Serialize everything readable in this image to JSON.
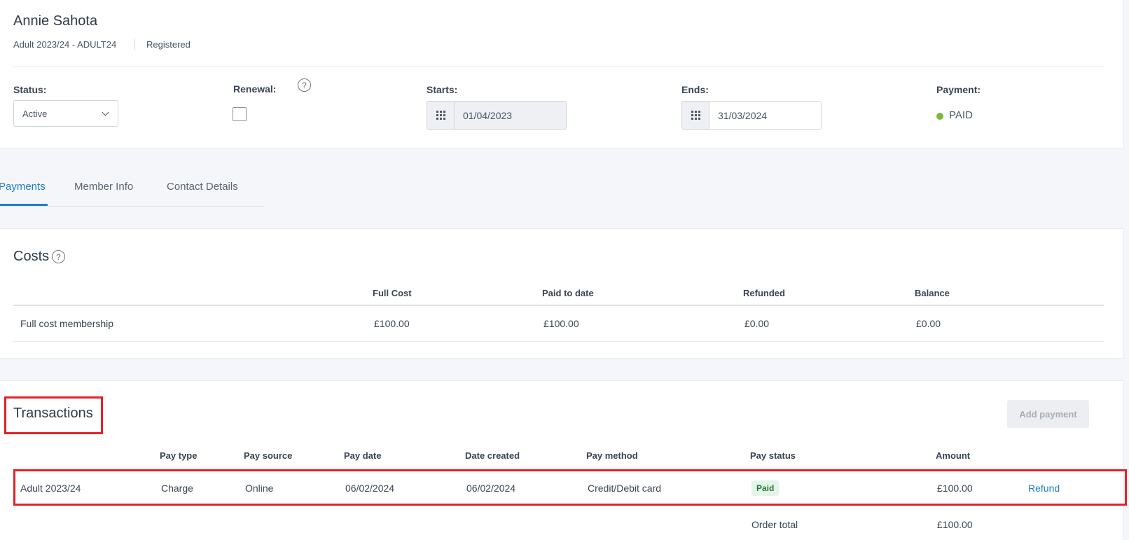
{
  "member": {
    "name": "Annie Sahota",
    "membership": "Adult 2023/24 - ADULT24",
    "registration_status": "Registered"
  },
  "fields": {
    "status_label": "Status:",
    "status_value": "Active",
    "renewal_label": "Renewal:",
    "help_glyph": "?",
    "starts_label": "Starts:",
    "starts_value": "01/04/2023",
    "ends_label": "Ends:",
    "ends_value": "31/03/2024",
    "payment_label": "Payment:",
    "payment_value": "PAID",
    "payment_color": "#7cb93a"
  },
  "tabs": [
    {
      "label": "Payments",
      "active": true
    },
    {
      "label": "Member Info",
      "active": false
    },
    {
      "label": "Contact Details",
      "active": false
    }
  ],
  "costs": {
    "title": "Costs",
    "headers": [
      "Full Cost",
      "Paid to date",
      "Refunded",
      "Balance"
    ],
    "rows": [
      {
        "name": "Full cost membership",
        "full_cost": "£100.00",
        "paid_to_date": "£100.00",
        "refunded": "£0.00",
        "balance": "£0.00"
      }
    ]
  },
  "transactions": {
    "title": "Transactions",
    "add_button": "Add payment",
    "headers": [
      "Pay type",
      "Pay source",
      "Pay date",
      "Date created",
      "Pay method",
      "Pay status",
      "Amount"
    ],
    "rows": [
      {
        "item": "Adult 2023/24",
        "pay_type": "Charge",
        "pay_source": "Online",
        "pay_date": "06/02/2024",
        "date_created": "06/02/2024",
        "pay_method": "Credit/Debit card",
        "pay_status": "Paid",
        "amount": "£100.00",
        "action": "Refund"
      }
    ],
    "order_total_label": "Order total",
    "order_total_value": "£100.00"
  },
  "colors": {
    "accent": "#1f7fc7",
    "highlight": "#e3222a",
    "paid_badge_bg": "#e4f4e8"
  },
  "icons": {
    "calendar": "calendar-grid-icon",
    "help": "help-circle-icon",
    "dropdown": "chevron-down-icon",
    "payment_status": "status-dot-icon"
  }
}
